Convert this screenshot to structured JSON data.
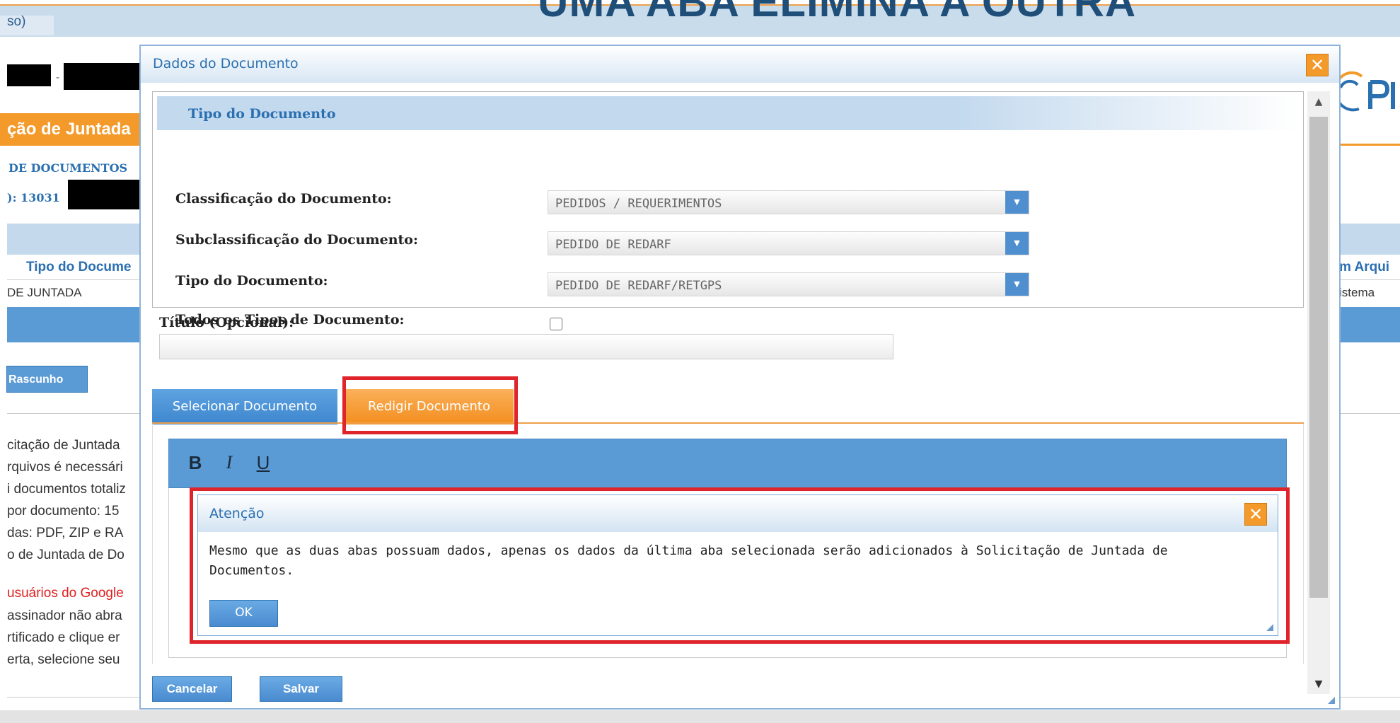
{
  "overlay_caption": "UMA ABA ELIMINA A OUTRA",
  "background": {
    "topbar_text": "so)",
    "dash": "-",
    "orange_title": "ção de Juntada",
    "label_documentos": "DE DOCUMENTOS",
    "label_number": "): 13031",
    "col_tipo": "Tipo do Docume",
    "col_arquivo": "m Arqui",
    "cell_juntada": "DE JUNTADA",
    "cell_sistema": "istema",
    "btn_rascunho": "Rascunho",
    "paragraphs": [
      "citação de Juntada",
      "rquivos é necessári",
      "i documentos totaliz",
      " por documento: 15",
      "das: PDF, ZIP e RA",
      "o de Juntada de Do"
    ],
    "red_line": "usuários do Google",
    "paragraphs2": [
      "assinador não abra",
      "rtificado e clique er",
      "erta, selecione seu"
    ],
    "brand_color": "#f39a2b"
  },
  "dialog": {
    "title": "Dados do Documento",
    "close_icon": "close-icon",
    "section_title": "Tipo do Documento",
    "fields": {
      "classificacao_label": "Classificação do Documento:",
      "classificacao_value": "PEDIDOS / REQUERIMENTOS",
      "subclassificacao_label": "Subclassificação do Documento:",
      "subclassificacao_value": "PEDIDO DE REDARF",
      "tipo_label": "Tipo do Documento:",
      "tipo_value": "PEDIDO DE REDARF/RETGPS",
      "todos_label": "Todos os Tipos de Documento:"
    },
    "titulo_label": "Título (Opcional):",
    "titulo_value": "",
    "tabs": {
      "selecionar": "Selecionar Documento",
      "redigir": "Redigir Documento"
    },
    "editor_toolbar": {
      "bold": "B",
      "italic": "I",
      "underline": "U"
    },
    "buttons": {
      "cancelar": "Cancelar",
      "salvar": "Salvar"
    },
    "accent_color": "#5b9bd5",
    "tab_active_color": "#f28e1e"
  },
  "alert": {
    "title": "Atenção",
    "message": "Mesmo que as duas abas possuam dados, apenas os dados da última aba selecionada serão adicionados à Solicitação de Juntada de Documentos.",
    "ok_label": "OK",
    "highlight_color": "#e0242c"
  }
}
